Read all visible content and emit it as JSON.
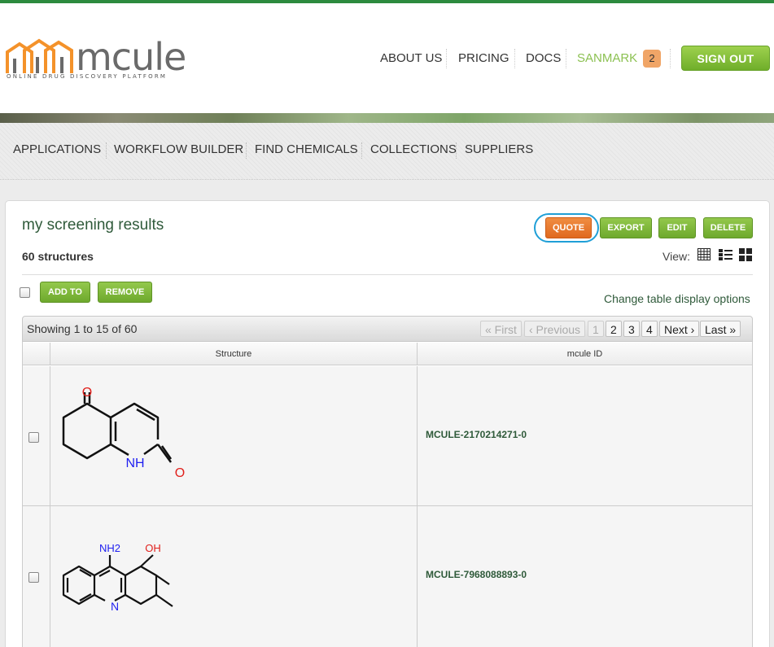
{
  "brand": {
    "name": "mcule",
    "tagline": "ONLINE DRUG DISCOVERY PLATFORM",
    "accent": "#8cc152",
    "orange": "#f4922a"
  },
  "topnav": {
    "items": [
      "ABOUT US",
      "PRICING",
      "DOCS"
    ],
    "user": "SANMARK",
    "badge": "2",
    "signout": "SIGN OUT"
  },
  "mainnav": {
    "items": [
      "APPLICATIONS",
      "WORKFLOW BUILDER",
      "FIND CHEMICALS",
      "COLLECTIONS",
      "SUPPLIERS"
    ]
  },
  "collection": {
    "title": "my screening results",
    "count": "60 structures",
    "actions": [
      "QUOTE",
      "EXPORT",
      "EDIT",
      "DELETE"
    ],
    "view_label": "View:",
    "view_icons": [
      "table-view-icon",
      "list-view-icon",
      "grid-view-icon"
    ]
  },
  "bulk": {
    "add_to": "ADD TO",
    "remove": "REMOVE",
    "change_options": "Change table display options"
  },
  "pagination": {
    "showing": "Showing 1 to 15 of 60",
    "first": "« First",
    "previous": "‹ Previous",
    "pages": [
      "1",
      "2",
      "3",
      "4"
    ],
    "current_page": "1",
    "next": "Next ›",
    "last": "Last »"
  },
  "table": {
    "columns": [
      "Structure",
      "mcule ID"
    ],
    "rows": [
      {
        "id": "MCULE-2170214271-0",
        "atom_labels": [
          "O",
          "NH",
          "O"
        ]
      },
      {
        "id": "MCULE-7968088893-0",
        "atom_labels": [
          "NH2",
          "OH",
          "N"
        ]
      }
    ]
  }
}
